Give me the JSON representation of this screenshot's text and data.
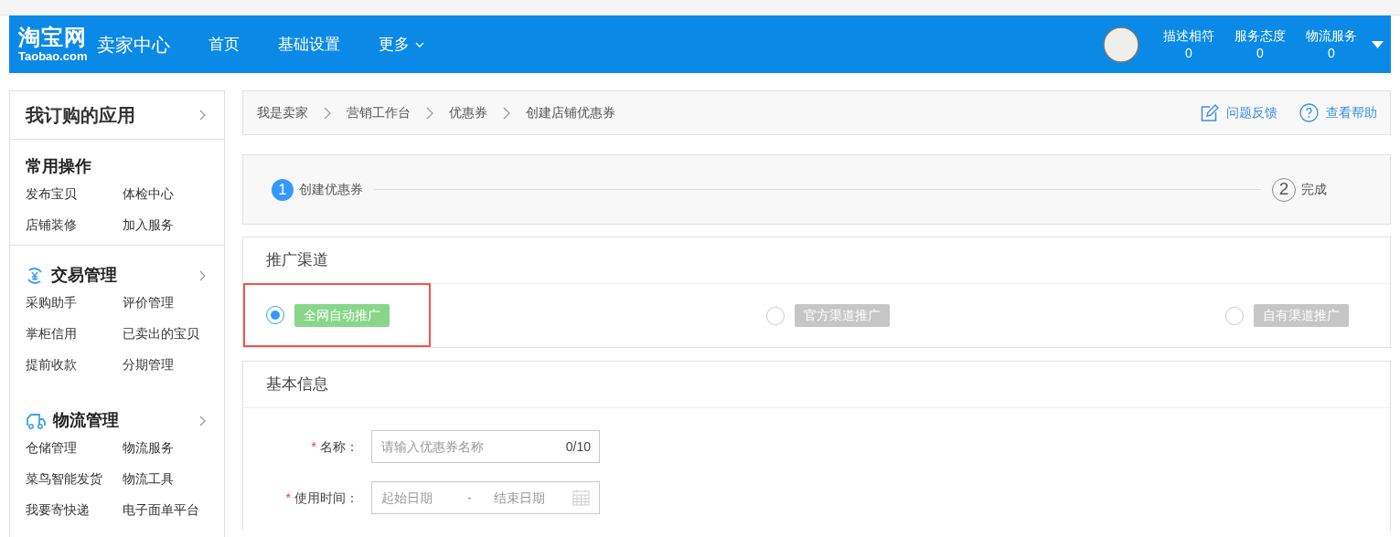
{
  "header": {
    "logo": {
      "main": "淘宝网",
      "sub": "Taobao.com"
    },
    "title": "卖家中心",
    "nav": [
      {
        "label": "首页",
        "dropdown": false
      },
      {
        "label": "基础设置",
        "dropdown": false
      },
      {
        "label": "更多",
        "dropdown": true
      }
    ],
    "ratings": [
      {
        "label": "描述相符",
        "value": "0"
      },
      {
        "label": "服务态度",
        "value": "0"
      },
      {
        "label": "物流服务",
        "value": "0"
      }
    ]
  },
  "sidebar": {
    "apps_header": "我订购的应用",
    "sections": [
      {
        "kind": "common",
        "title": "常用操作",
        "items": [
          "发布宝贝",
          "体检中心",
          "店铺装修",
          "加入服务"
        ]
      },
      {
        "kind": "trade",
        "title": "交易管理",
        "items": [
          "采购助手",
          "评价管理",
          "掌柜信用",
          "已卖出的宝贝",
          "提前收款",
          "分期管理"
        ]
      },
      {
        "kind": "logistics",
        "title": "物流管理",
        "items": [
          "仓储管理",
          "物流服务",
          "菜鸟智能发货",
          "物流工具",
          "我要寄快递",
          "电子面单平台"
        ]
      }
    ]
  },
  "breadcrumb": {
    "items": [
      "我是卖家",
      "营销工作台",
      "优惠券",
      "创建店铺优惠券"
    ],
    "links": [
      {
        "kind": "feedback",
        "label": "问题反馈"
      },
      {
        "kind": "help",
        "label": "查看帮助"
      }
    ]
  },
  "steps": [
    {
      "number": "1",
      "label": "创建优惠券",
      "active": true
    },
    {
      "number": "2",
      "label": "完成",
      "active": false
    }
  ],
  "channels": {
    "title": "推广渠道",
    "options": [
      {
        "label": "全网自动推广",
        "selected": true,
        "highlighted": true
      },
      {
        "label": "官方渠道推广",
        "selected": false,
        "highlighted": false
      },
      {
        "label": "自有渠道推广",
        "selected": false,
        "highlighted": false
      }
    ]
  },
  "basic_info": {
    "title": "基本信息",
    "fields": [
      {
        "kind": "text",
        "label": "名称：",
        "required_mark": "*",
        "placeholder": "请输入优惠券名称",
        "counter": "0/10"
      },
      {
        "kind": "daterange",
        "label": "使用时间：",
        "required_mark": "*",
        "start_placeholder": "起始日期",
        "separator": "-",
        "end_placeholder": "结束日期"
      }
    ]
  }
}
